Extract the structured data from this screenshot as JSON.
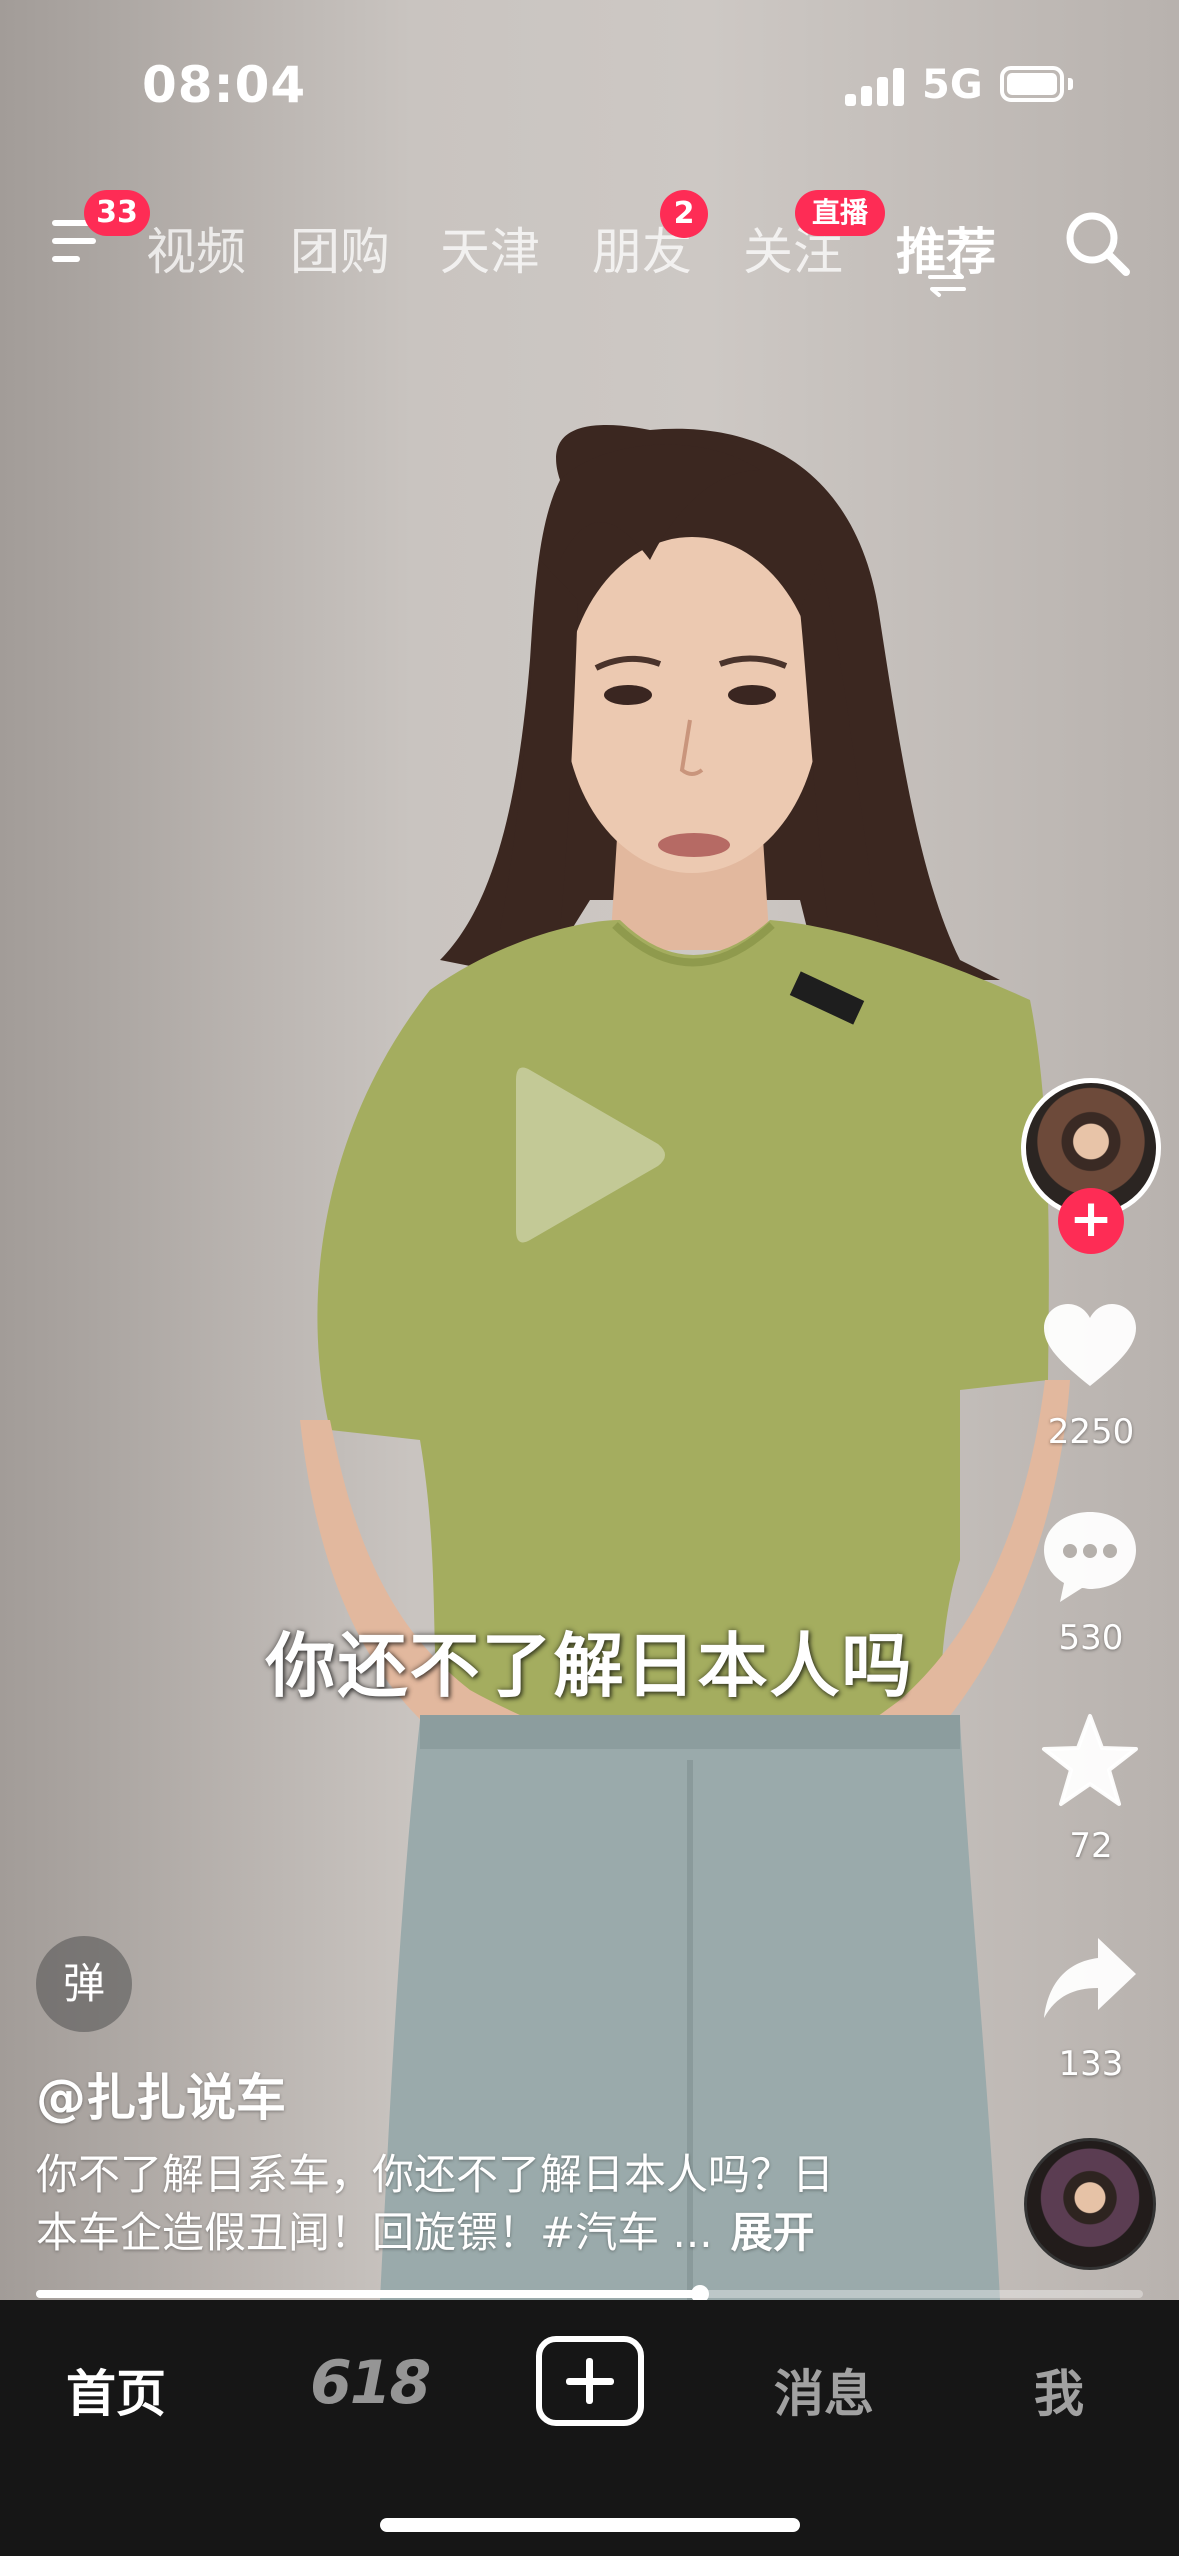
{
  "status_bar": {
    "time": "08:04",
    "network": "5G",
    "signal_bars": 4,
    "battery_level": 1.0
  },
  "top_nav": {
    "menu_badge": "33",
    "tabs": [
      {
        "label": "视频"
      },
      {
        "label": "团购"
      },
      {
        "label": "天津"
      },
      {
        "label": "朋友",
        "badge": "2"
      },
      {
        "label": "关注",
        "badge": "直播"
      },
      {
        "label": "推荐",
        "active": true
      }
    ],
    "icons": [
      "menu-icon",
      "swap-icon",
      "search-icon"
    ]
  },
  "video": {
    "subtitle": "你还不了解日本人吗",
    "paused": true
  },
  "actions": {
    "likes": "2250",
    "comments": "530",
    "favorites": "72",
    "shares": "133",
    "follow_symbol": "+"
  },
  "info": {
    "danmaku_label": "弹",
    "author": "@扎扎说车",
    "caption_line1": "你不了解日系车，你还不了解日本人吗？日",
    "caption_line2": "本车企造假丑闻！回旋镖！#汽车 ...",
    "expand_label": "展开",
    "progress": 0.6
  },
  "tab_bar": {
    "home": "首页",
    "promo": "618",
    "messages": "消息",
    "me": "我"
  },
  "colors": {
    "accent": "#fe2c55",
    "tab_bar_bg": "#161616",
    "shirt": "#a4ad5f",
    "jeans": "#9aaaab"
  }
}
